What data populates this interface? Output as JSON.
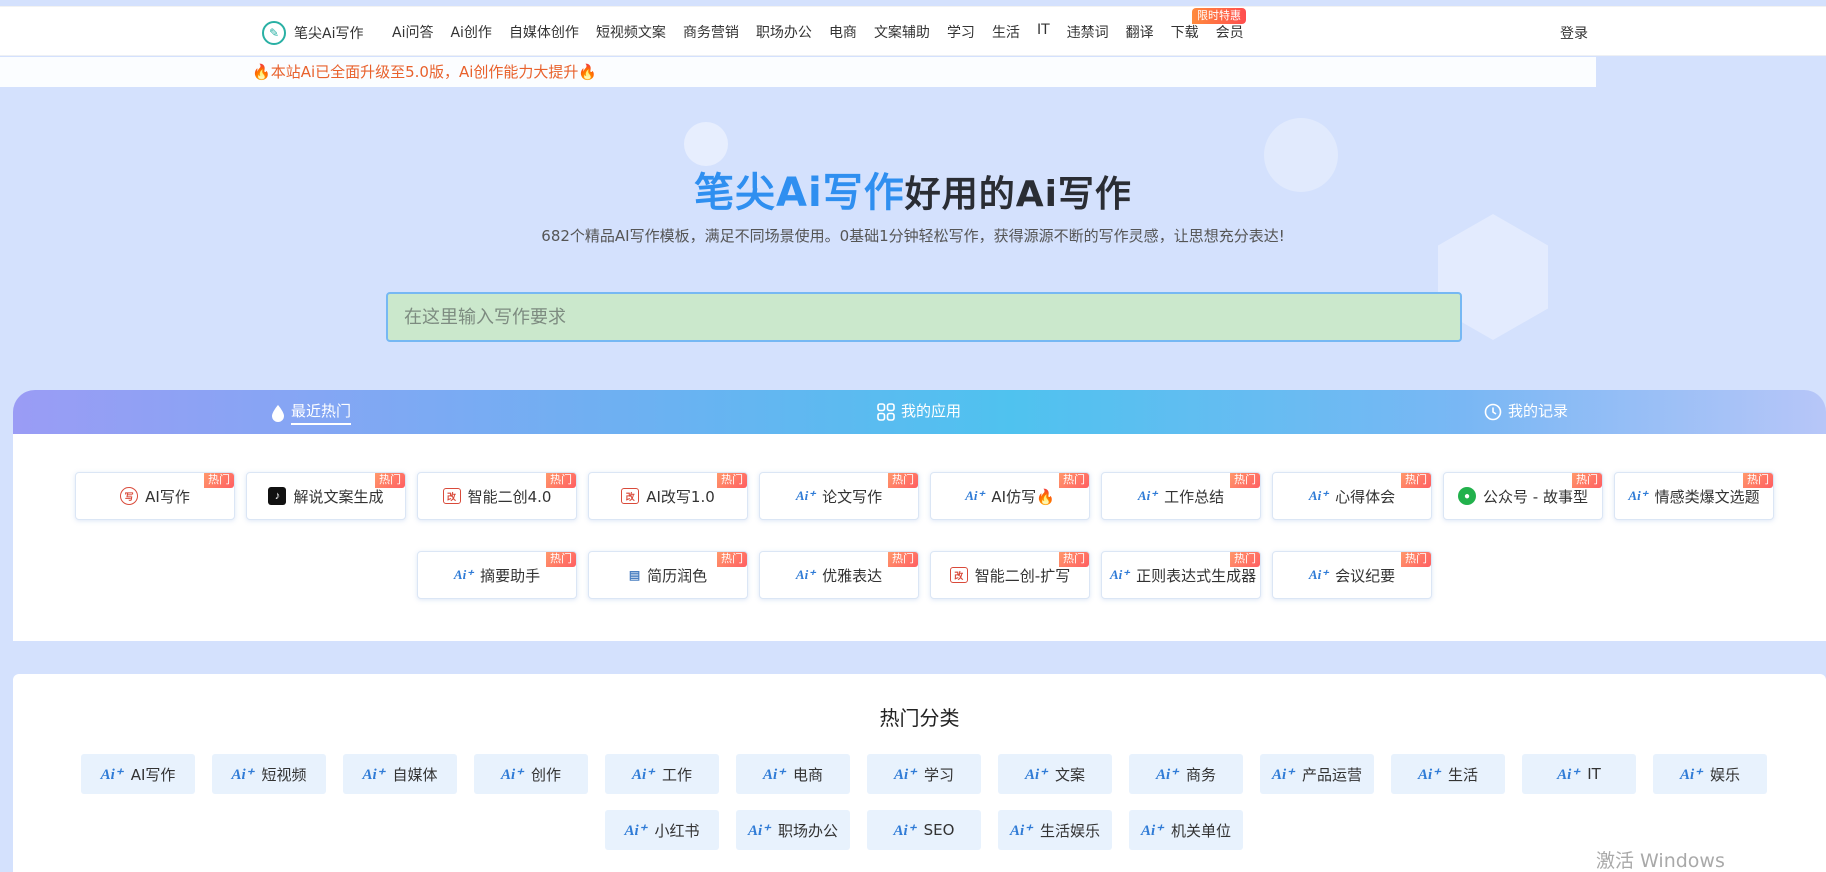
{
  "header": {
    "logo_text": "笔尖Ai写作",
    "nav": [
      "Ai问答",
      "Ai创作",
      "自媒体创作",
      "短视频文案",
      "商务营销",
      "职场办公",
      "电商",
      "文案辅助",
      "学习",
      "生活",
      "IT",
      "违禁词",
      "翻译",
      "下载",
      "会员"
    ],
    "vip_badge": "限时特惠",
    "login": "登录"
  },
  "notice": {
    "text": "本站Ai已全面升级至5.0版，Ai创作能力大提升",
    "emoji": "🔥"
  },
  "hero": {
    "title_blue": "笔尖Ai写作",
    "title_dark": "好用的Ai写作",
    "subtitle": "682个精品AI写作模板，满足不同场景使用。0基础1分钟轻松写作，获得源源不断的写作灵感，让思想充分表达!",
    "search_placeholder": "在这里输入写作要求"
  },
  "tabs": [
    {
      "label": "最近热门",
      "icon": "droplet-icon",
      "active": true
    },
    {
      "label": "我的应用",
      "icon": "grid-icon",
      "active": false
    },
    {
      "label": "我的记录",
      "icon": "clock-icon",
      "active": false
    }
  ],
  "hot_badge": "热门",
  "apps": [
    {
      "label": "AI写作",
      "icon": "ai-write-icon",
      "hot": true
    },
    {
      "label": "解说文案生成",
      "icon": "tiktok-icon",
      "hot": true
    },
    {
      "label": "智能二创4.0",
      "icon": "rewrite-icon",
      "hot": true
    },
    {
      "label": "AI改写1.0",
      "icon": "rewrite-icon",
      "hot": true
    },
    {
      "label": "论文写作",
      "icon": "ai-icon",
      "hot": true
    },
    {
      "label": "AI仿写🔥",
      "icon": "ai-icon",
      "hot": true
    },
    {
      "label": "工作总结",
      "icon": "ai-icon",
      "hot": true
    },
    {
      "label": "心得体会",
      "icon": "ai-icon",
      "hot": true
    },
    {
      "label": "公众号 - 故事型",
      "icon": "wechat-icon",
      "hot": true
    },
    {
      "label": "情感类爆文选题",
      "icon": "ai-icon",
      "hot": true
    },
    {
      "label": "摘要助手",
      "icon": "ai-icon",
      "hot": true
    },
    {
      "label": "简历润色",
      "icon": "resume-icon",
      "hot": true
    },
    {
      "label": "优雅表达",
      "icon": "ai-icon",
      "hot": true
    },
    {
      "label": "智能二创-扩写",
      "icon": "rewrite-icon",
      "hot": true
    },
    {
      "label": "正则表达式生成器",
      "icon": "ai-icon",
      "hot": true
    },
    {
      "label": "会议纪要",
      "icon": "ai-icon",
      "hot": true
    }
  ],
  "categories": {
    "title": "热门分类",
    "items": [
      "AI写作",
      "短视频",
      "自媒体",
      "创作",
      "工作",
      "电商",
      "学习",
      "文案",
      "商务",
      "产品运营",
      "生活",
      "IT",
      "娱乐",
      "小红书",
      "职场办公",
      "SEO",
      "生活娱乐",
      "机关单位"
    ]
  },
  "watermark": "激活 Windows",
  "colors": {
    "brand_blue": "#2f8ff0",
    "notice_orange": "#e8612c",
    "hot_red": "#ff5e62",
    "page_bg": "#d4e1fd"
  }
}
